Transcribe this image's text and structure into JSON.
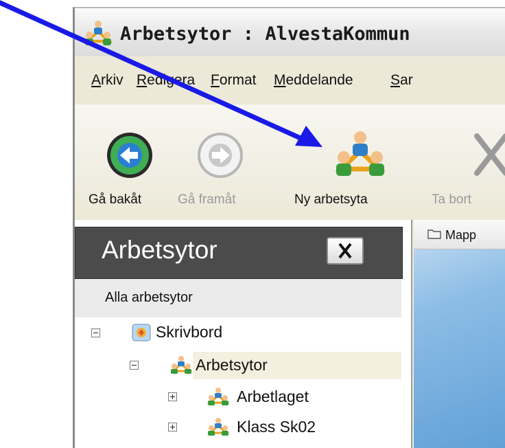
{
  "window": {
    "title": "Arbetsytor : AlvestaKommun",
    "title_icon": "workspace-people-icon"
  },
  "menu": {
    "items": [
      {
        "accel": "A",
        "rest": "rkiv"
      },
      {
        "accel": "R",
        "rest": "edigera"
      },
      {
        "accel": "F",
        "rest": "ormat"
      },
      {
        "accel": "M",
        "rest": "eddelande"
      },
      {
        "accel": "S",
        "rest": "ar"
      }
    ]
  },
  "toolbar": {
    "back_label": "Gå bakåt",
    "forward_label": "Gå framåt",
    "new_workspace_label": "Ny arbetsyta",
    "delete_label": "Ta bort"
  },
  "sidebar": {
    "title": "Arbetsytor",
    "all_label": "Alla arbetsytor",
    "tree": [
      {
        "label": "Skrivbord",
        "icon": "desktop-icon",
        "expander": "minus"
      },
      {
        "label": "Arbetsytor",
        "icon": "workspace-people-icon",
        "expander": "minus",
        "selected": true
      },
      {
        "label": "Arbetlaget",
        "icon": "workspace-people-icon",
        "expander": "plus"
      },
      {
        "label": "Klass Sk02",
        "icon": "workspace-people-icon",
        "expander": "plus"
      }
    ]
  },
  "content": {
    "tab_label": "Mapp"
  },
  "colors": {
    "annotation_arrow": "#1a1ae6",
    "sidebar_header": "#4b4b4b",
    "back_button_green": "#3fae55"
  }
}
